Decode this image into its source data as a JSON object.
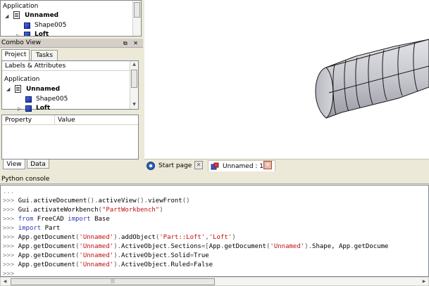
{
  "top_tree": {
    "root_label": "Application",
    "document_label": "Unnamed",
    "items": [
      {
        "label": "Shape005"
      },
      {
        "label": "Loft"
      }
    ]
  },
  "combo_view": {
    "title": "Combo View",
    "title_buttons": "⧉ ✕",
    "tabs": [
      {
        "label": "Project",
        "active": true
      },
      {
        "label": "Tasks",
        "active": false
      }
    ],
    "tree_header": "Labels & Attributes",
    "root_label": "Application",
    "document_label": "Unnamed",
    "items": [
      {
        "label": "Shape005"
      },
      {
        "label": "Loft"
      }
    ],
    "property_headers": {
      "col1": "Property",
      "col2": "Value"
    },
    "bottom_tabs": [
      {
        "label": "View",
        "active": true
      },
      {
        "label": "Data",
        "active": false
      }
    ]
  },
  "doc_tabs": [
    {
      "label": "Start page",
      "icon": "freecad-icon"
    },
    {
      "label": "Unnamed : 1*",
      "icon": "part-icon"
    }
  ],
  "python_console": {
    "title": "Python console",
    "lines": [
      {
        "prompt": "...",
        "segments": []
      },
      {
        "prompt": ">>> ",
        "segments": [
          {
            "t": "Gui",
            "c": ""
          },
          {
            "t": ".",
            "c": "p"
          },
          {
            "t": "activeDocument",
            "c": ""
          },
          {
            "t": "().",
            "c": "p"
          },
          {
            "t": "activeView",
            "c": ""
          },
          {
            "t": "().",
            "c": "p"
          },
          {
            "t": "viewFront",
            "c": ""
          },
          {
            "t": "()",
            "c": "p"
          }
        ]
      },
      {
        "prompt": ">>> ",
        "segments": [
          {
            "t": "Gui",
            "c": ""
          },
          {
            "t": ".",
            "c": "p"
          },
          {
            "t": "activateWorkbench",
            "c": ""
          },
          {
            "t": "(",
            "c": "p"
          },
          {
            "t": "\"PartWorkbench\"",
            "c": "str"
          },
          {
            "t": ")",
            "c": "p"
          }
        ]
      },
      {
        "prompt": ">>> ",
        "segments": [
          {
            "t": "from",
            "c": "kw"
          },
          {
            "t": " FreeCAD ",
            "c": ""
          },
          {
            "t": "import",
            "c": "kw"
          },
          {
            "t": " Base",
            "c": ""
          }
        ]
      },
      {
        "prompt": ">>> ",
        "segments": [
          {
            "t": "import",
            "c": "kw"
          },
          {
            "t": " Part",
            "c": ""
          }
        ]
      },
      {
        "prompt": ">>> ",
        "segments": [
          {
            "t": "App",
            "c": ""
          },
          {
            "t": ".",
            "c": "p"
          },
          {
            "t": "getDocument",
            "c": ""
          },
          {
            "t": "(",
            "c": "p"
          },
          {
            "t": "'Unnamed'",
            "c": "str"
          },
          {
            "t": ").",
            "c": "p"
          },
          {
            "t": "addObject",
            "c": ""
          },
          {
            "t": "(",
            "c": "p"
          },
          {
            "t": "'Part::Loft'",
            "c": "str"
          },
          {
            "t": ",",
            "c": "p"
          },
          {
            "t": "'Loft'",
            "c": "str"
          },
          {
            "t": ")",
            "c": "p"
          }
        ]
      },
      {
        "prompt": ">>> ",
        "segments": [
          {
            "t": "App",
            "c": ""
          },
          {
            "t": ".",
            "c": "p"
          },
          {
            "t": "getDocument",
            "c": ""
          },
          {
            "t": "(",
            "c": "p"
          },
          {
            "t": "'Unnamed'",
            "c": "str"
          },
          {
            "t": ").",
            "c": "p"
          },
          {
            "t": "ActiveObject",
            "c": ""
          },
          {
            "t": ".",
            "c": "p"
          },
          {
            "t": "Sections",
            "c": ""
          },
          {
            "t": "=[",
            "c": "p"
          },
          {
            "t": "App",
            "c": ""
          },
          {
            "t": ".",
            "c": "p"
          },
          {
            "t": "getDocument",
            "c": ""
          },
          {
            "t": "(",
            "c": "p"
          },
          {
            "t": "'Unnamed'",
            "c": "str"
          },
          {
            "t": ").",
            "c": "p"
          },
          {
            "t": "Shape, App",
            "c": ""
          },
          {
            "t": ".",
            "c": "p"
          },
          {
            "t": "getDocume",
            "c": ""
          }
        ]
      },
      {
        "prompt": ">>> ",
        "segments": [
          {
            "t": "App",
            "c": ""
          },
          {
            "t": ".",
            "c": "p"
          },
          {
            "t": "getDocument",
            "c": ""
          },
          {
            "t": "(",
            "c": "p"
          },
          {
            "t": "'Unnamed'",
            "c": "str"
          },
          {
            "t": ").",
            "c": "p"
          },
          {
            "t": "ActiveObject",
            "c": ""
          },
          {
            "t": ".",
            "c": "p"
          },
          {
            "t": "Solid",
            "c": ""
          },
          {
            "t": "=",
            "c": "p"
          },
          {
            "t": "True",
            "c": ""
          }
        ]
      },
      {
        "prompt": ">>> ",
        "segments": [
          {
            "t": "App",
            "c": ""
          },
          {
            "t": ".",
            "c": "p"
          },
          {
            "t": "getDocument",
            "c": ""
          },
          {
            "t": "(",
            "c": "p"
          },
          {
            "t": "'Unnamed'",
            "c": "str"
          },
          {
            "t": ").",
            "c": "p"
          },
          {
            "t": "ActiveObject",
            "c": ""
          },
          {
            "t": ".",
            "c": "p"
          },
          {
            "t": "Ruled",
            "c": ""
          },
          {
            "t": "=",
            "c": "p"
          },
          {
            "t": "False",
            "c": ""
          }
        ]
      },
      {
        "prompt": ">>>",
        "segments": []
      }
    ]
  },
  "colors": {
    "keyword": "#2b3cba",
    "string": "#c01010",
    "prompt": "#888888",
    "shape_face": "#c8c8d0",
    "shape_edge": "#1a1a1a"
  }
}
